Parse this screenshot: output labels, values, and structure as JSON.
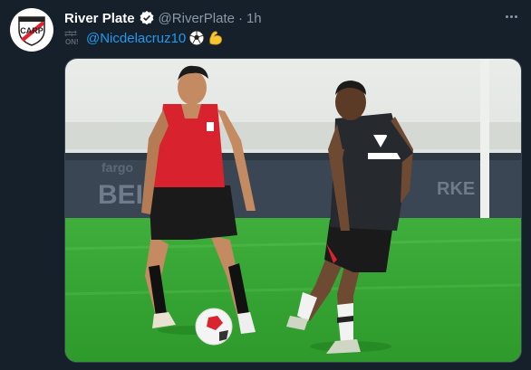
{
  "tweet": {
    "author_name": "River Plate",
    "author_handle": "@RiverPlate",
    "separator": "·",
    "time": "1h",
    "on_label": "ON!",
    "mention": "@Nicdelacruz10",
    "emojis": [
      "soccer-ball",
      "flexed-biceps"
    ],
    "verified": true
  },
  "colors": {
    "background": "#15202b",
    "link": "#1d9bf0",
    "muted": "#8b98a5",
    "brand_red": "#e4202e"
  },
  "icons": [
    "river-plate-crest-icon",
    "verified-badge-icon",
    "more-options-icon",
    "on-transfer-icon",
    "soccer-ball-emoji-icon",
    "flexed-biceps-emoji-icon"
  ]
}
